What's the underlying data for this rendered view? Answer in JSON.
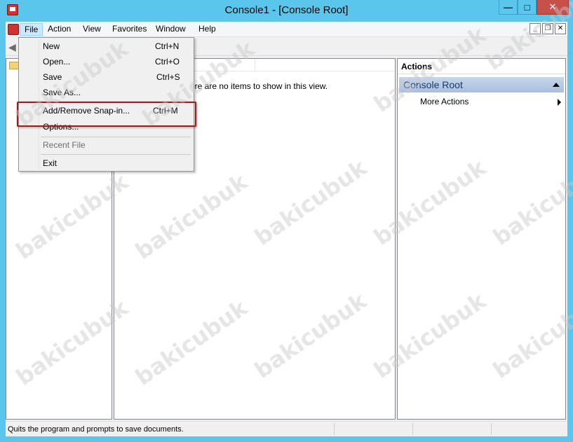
{
  "window": {
    "title": "Console1 - [Console Root]",
    "min_glyph": "—",
    "max_glyph": "□",
    "close_glyph": "✕"
  },
  "menubar": {
    "items": [
      "File",
      "Action",
      "View",
      "Favorites",
      "Window",
      "Help"
    ],
    "mdi_min": "_",
    "mdi_restore": "❐",
    "mdi_close": "✕"
  },
  "file_menu": {
    "items": [
      {
        "label": "New",
        "shortcut": "Ctrl+N"
      },
      {
        "label": "Open...",
        "shortcut": "Ctrl+O"
      },
      {
        "label": "Save",
        "shortcut": "Ctrl+S"
      },
      {
        "label": "Save As...",
        "shortcut": ""
      },
      {
        "label": "Add/Remove Snap-in...",
        "shortcut": "Ctrl+M"
      },
      {
        "label": "Options...",
        "shortcut": ""
      },
      {
        "label": "Recent File",
        "shortcut": ""
      },
      {
        "label": "Exit",
        "shortcut": ""
      }
    ]
  },
  "center": {
    "empty_message": "ere are no items to show in this view."
  },
  "actions": {
    "title": "Actions",
    "group": "Console Root",
    "more": "More Actions"
  },
  "status": {
    "text": "Quits the program and prompts to save documents."
  },
  "watermark": "bakicubuk",
  "colors": {
    "titlebar": "#5bc6ec",
    "highlight_border": "#a01c1c",
    "actions_group": "#b6c9e6"
  }
}
